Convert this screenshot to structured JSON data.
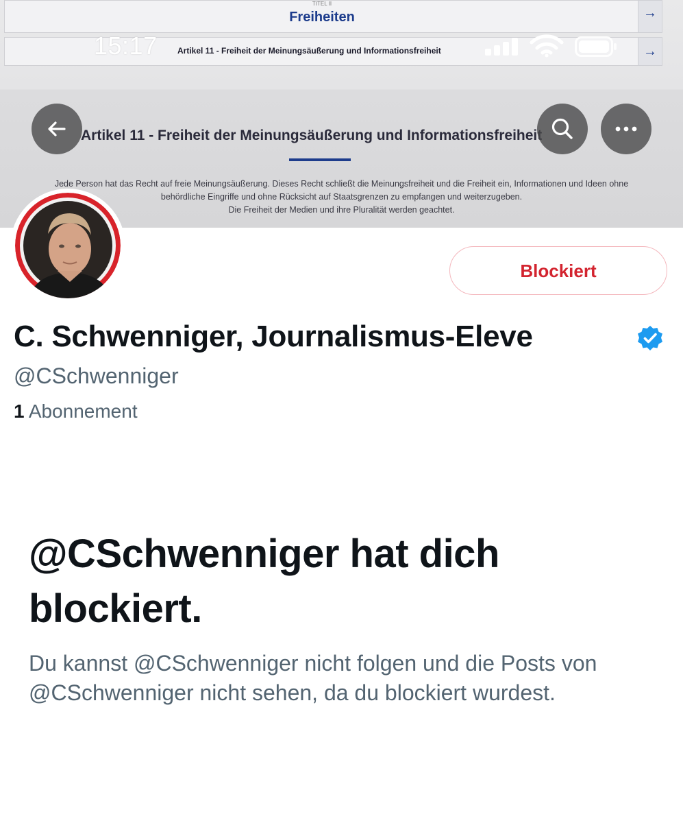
{
  "status_bar": {
    "time": "15:17"
  },
  "banner": {
    "nav_rows": [
      {
        "small_label": "TITEL II",
        "label": "Freiheiten",
        "arrow": "→"
      },
      {
        "label": "Artikel 11 - Freiheit der Meinungsäußerung und Informationsfreiheit",
        "arrow": "→"
      }
    ],
    "article_title": "Artikel 11 - Freiheit der Meinungsäußerung und Informationsfreiheit",
    "article_text": [
      "Jede Person hat das Recht auf freie Meinungsäußerung. Dieses Recht schließt die Meinungsfreiheit und die Freiheit ein, Informationen und Ideen ohne",
      "behördliche Eingriffe und ohne Rücksicht auf Staatsgrenzen zu empfangen und weiterzugeben.",
      "Die Freiheit der Medien und ihre Pluralität werden geachtet."
    ]
  },
  "profile": {
    "display_name": "C. Schwenniger, Journalismus-Eleve",
    "handle": "@CSchwenniger",
    "following_count": "1",
    "following_label": "Abonnement",
    "blocked_button": "Blockiert",
    "verified_icon": "verified-badge-icon"
  },
  "block_notice": {
    "title": "@CSchwenniger hat dich blockiert.",
    "description": "Du kannst @CSchwenniger nicht folgen und die Posts von @CSchwenniger nicht sehen, da du blockiert wurdest."
  },
  "colors": {
    "blocked_red": "#d3242f",
    "verified_blue": "#1d9bf0",
    "secondary_text": "#536471",
    "primary_text": "#0f1419",
    "eu_blue": "#1d3c8c"
  }
}
